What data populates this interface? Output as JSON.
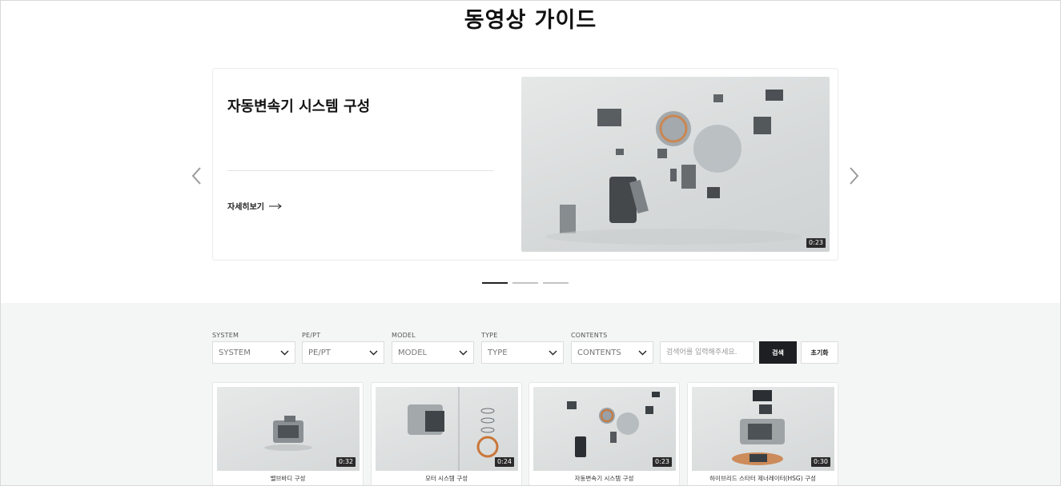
{
  "page": {
    "title": "동영상 가이드"
  },
  "hero": {
    "title": "자동변속기 시스템 구성",
    "more_label": "자세히보기",
    "duration": "0:23"
  },
  "carousel": {
    "slide_count": 3,
    "active_index": 0
  },
  "filters": [
    {
      "label": "SYSTEM",
      "value": "SYSTEM"
    },
    {
      "label": "PE/PT",
      "value": "PE/PT"
    },
    {
      "label": "MODEL",
      "value": "MODEL"
    },
    {
      "label": "TYPE",
      "value": "TYPE"
    },
    {
      "label": "CONTENTS",
      "value": "CONTENTS"
    }
  ],
  "search": {
    "placeholder": "검색어를 입력해주세요.",
    "search_label": "검색",
    "reset_label": "초기화"
  },
  "videos": [
    {
      "title": "밸브바디 구성",
      "duration": "0:32"
    },
    {
      "title": "모터 시스템 구성",
      "duration": "0:24"
    },
    {
      "title": "자동변속기 시스템 구성",
      "duration": "0:23"
    },
    {
      "title": "하이브리드 스타터 제너레이터(HSG) 구성",
      "duration": "0:30"
    }
  ],
  "colors": {
    "primary_button": "#1d1f22",
    "section_bg": "#f4f6f5",
    "dot_active": "#222222",
    "dot_inactive": "#c4c4c4"
  }
}
